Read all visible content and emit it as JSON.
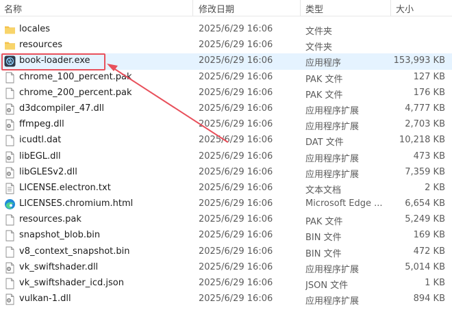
{
  "header": {
    "name": "名称",
    "date": "修改日期",
    "type": "类型",
    "size": "大小"
  },
  "files": [
    {
      "name": "locales",
      "date": "2025/6/29 16:06",
      "type": "文件夹",
      "size": "",
      "icon": "folder-icon"
    },
    {
      "name": "resources",
      "date": "2025/6/29 16:06",
      "type": "文件夹",
      "size": "",
      "icon": "folder-icon"
    },
    {
      "name": "book-loader.exe",
      "date": "2025/6/29 16:06",
      "type": "应用程序",
      "size": "153,993 KB",
      "icon": "app-exe-icon"
    },
    {
      "name": "chrome_100_percent.pak",
      "date": "2025/6/29 16:06",
      "type": "PAK 文件",
      "size": "127 KB",
      "icon": "file-icon"
    },
    {
      "name": "chrome_200_percent.pak",
      "date": "2025/6/29 16:06",
      "type": "PAK 文件",
      "size": "176 KB",
      "icon": "file-icon"
    },
    {
      "name": "d3dcompiler_47.dll",
      "date": "2025/6/29 16:06",
      "type": "应用程序扩展",
      "size": "4,777 KB",
      "icon": "dll-icon"
    },
    {
      "name": "ffmpeg.dll",
      "date": "2025/6/29 16:06",
      "type": "应用程序扩展",
      "size": "2,703 KB",
      "icon": "dll-icon"
    },
    {
      "name": "icudtl.dat",
      "date": "2025/6/29 16:06",
      "type": "DAT 文件",
      "size": "10,218 KB",
      "icon": "file-icon"
    },
    {
      "name": "libEGL.dll",
      "date": "2025/6/29 16:06",
      "type": "应用程序扩展",
      "size": "473 KB",
      "icon": "dll-icon"
    },
    {
      "name": "libGLESv2.dll",
      "date": "2025/6/29 16:06",
      "type": "应用程序扩展",
      "size": "7,359 KB",
      "icon": "dll-icon"
    },
    {
      "name": "LICENSE.electron.txt",
      "date": "2025/6/29 16:06",
      "type": "文本文档",
      "size": "2 KB",
      "icon": "text-file-icon"
    },
    {
      "name": "LICENSES.chromium.html",
      "date": "2025/6/29 16:06",
      "type": "Microsoft Edge ...",
      "size": "6,654 KB",
      "icon": "edge-icon"
    },
    {
      "name": "resources.pak",
      "date": "2025/6/29 16:06",
      "type": "PAK 文件",
      "size": "5,249 KB",
      "icon": "file-icon"
    },
    {
      "name": "snapshot_blob.bin",
      "date": "2025/6/29 16:06",
      "type": "BIN 文件",
      "size": "169 KB",
      "icon": "file-icon"
    },
    {
      "name": "v8_context_snapshot.bin",
      "date": "2025/6/29 16:06",
      "type": "BIN 文件",
      "size": "472 KB",
      "icon": "file-icon"
    },
    {
      "name": "vk_swiftshader.dll",
      "date": "2025/6/29 16:06",
      "type": "应用程序扩展",
      "size": "5,014 KB",
      "icon": "dll-icon"
    },
    {
      "name": "vk_swiftshader_icd.json",
      "date": "2025/6/29 16:06",
      "type": "JSON 文件",
      "size": "1 KB",
      "icon": "file-icon"
    },
    {
      "name": "vulkan-1.dll",
      "date": "2025/6/29 16:06",
      "type": "应用程序扩展",
      "size": "894 KB",
      "icon": "dll-icon"
    }
  ],
  "selected_index": 2,
  "colors": {
    "selection": "#e5f3ff",
    "annotation": "#e8505b",
    "folder": "#f4c24d"
  }
}
